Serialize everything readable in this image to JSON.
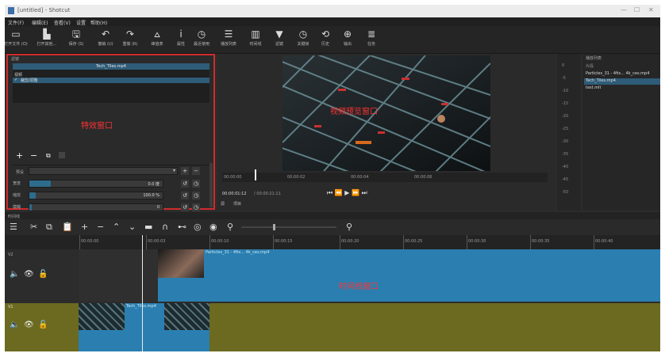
{
  "window": {
    "title": "[untitled] - Shotcut",
    "min": "—",
    "max": "☐",
    "close": "✕"
  },
  "menu": [
    "文件(F)",
    "编辑(E)",
    "查看(V)",
    "设置",
    "帮助(H)"
  ],
  "toolbar": [
    {
      "label": "打开文件 (O)",
      "icon": "folder-open-icon",
      "glyph": "▭"
    },
    {
      "label": "打开其他…",
      "icon": "open-other-icon",
      "glyph": "▙"
    },
    {
      "label": "保存 (S)",
      "icon": "save-icon",
      "glyph": "🖫"
    },
    {
      "label": "撤销 (U)",
      "icon": "undo-icon",
      "glyph": "↶"
    },
    {
      "label": "重做 (R)",
      "icon": "redo-icon",
      "glyph": "↷"
    },
    {
      "label": "峰值表",
      "icon": "peak-meter-icon",
      "glyph": "⩟"
    },
    {
      "label": "属性",
      "icon": "info-icon",
      "glyph": "i"
    },
    {
      "label": "最近使用",
      "icon": "recent-icon",
      "glyph": "◷"
    },
    {
      "label": "播放列表",
      "icon": "playlist-icon",
      "glyph": "☰"
    },
    {
      "label": "时间线",
      "icon": "timeline-icon",
      "glyph": "▥"
    },
    {
      "label": "滤镜",
      "icon": "filter-icon",
      "glyph": "▼"
    },
    {
      "label": "关键帧",
      "icon": "keyframes-icon",
      "glyph": "◷"
    },
    {
      "label": "历史",
      "icon": "history-icon",
      "glyph": "⟲"
    },
    {
      "label": "输出",
      "icon": "export-icon",
      "glyph": "⊕"
    },
    {
      "label": "任务",
      "icon": "jobs-icon",
      "glyph": "≣"
    }
  ],
  "filters": {
    "header": "滤镜",
    "clip_name": "Tech_Tiles.mp4",
    "section": "视频",
    "item": "裁剪/调整",
    "label": "特效窗口",
    "preset_label": "预设",
    "rows": [
      {
        "name": "宽度",
        "value": "0.0 度",
        "fill": 0.16
      },
      {
        "name": "缩放",
        "value": "100.0 %",
        "fill": 0.05
      },
      {
        "name": "模糊",
        "value": "0",
        "fill": 0.02
      }
    ]
  },
  "viewer": {
    "label": "视频预览窗口",
    "time_current": "00:00:01:12",
    "time_total": "/ 00:00:21:11",
    "scrub": [
      "00:00:00",
      "00:00:02",
      "00:00:04",
      "00:00:06"
    ],
    "sub_tabs": [
      "源",
      "项目"
    ]
  },
  "meter": {
    "scale": [
      "0",
      "-5",
      "-10",
      "-15",
      "-20",
      "-25",
      "-30",
      "-35",
      "-40",
      "-45",
      "-50"
    ]
  },
  "playlist": {
    "header": "播放列表",
    "col": "片段",
    "items": [
      "Particles_31 - 4fix... 4k_ces.mp4",
      "Tech_Tiles.mp4",
      "test.mlt"
    ]
  },
  "timeline": {
    "header": "时间线",
    "ruler": [
      "00:00:00",
      "00:00:03",
      "00:00:10",
      "00:00:15",
      "00:00:20",
      "00:00:25",
      "00:00:30",
      "00:00:35",
      "00:00:40"
    ],
    "track_v2": "V2",
    "track_v1": "V1",
    "label": "时间线窗口",
    "clip_v2": "Particles_31 - 4fix... 4k_ces.mp4",
    "clip_v1": "Tech_Tiles.mp4"
  }
}
